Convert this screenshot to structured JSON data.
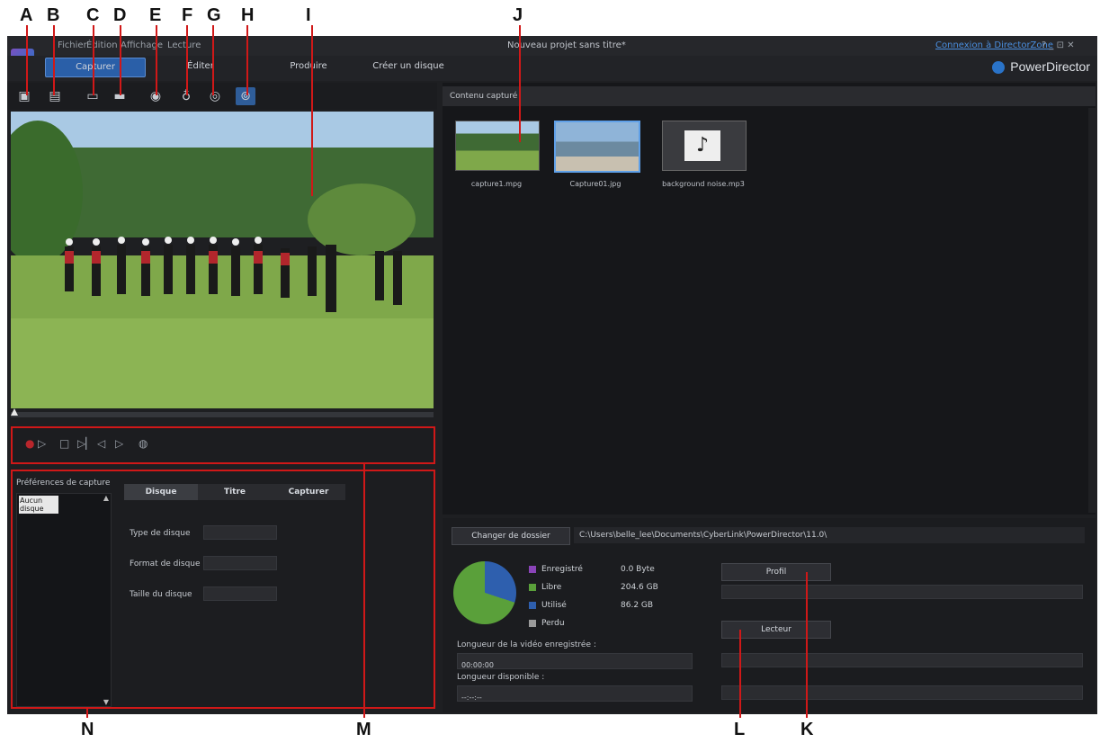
{
  "callouts": [
    "A",
    "B",
    "C",
    "D",
    "E",
    "F",
    "G",
    "H",
    "I",
    "J",
    "K",
    "L",
    "M",
    "N"
  ],
  "menu": {
    "items": [
      "Fichier",
      "Édition",
      "Affichage",
      "Lecture"
    ],
    "project_title": "Nouveau projet sans titre*",
    "connect_link": "Connexion à DirectorZone",
    "window_icons": "?  _  ⊡  ✕"
  },
  "modes": {
    "capture": "Capturer",
    "edit": "Éditer",
    "produce": "Produire",
    "disc": "Créer un disque"
  },
  "brand": {
    "name": "PowerDirector",
    "accent": "#2a73c8"
  },
  "toolbar_icons": [
    "capture-camera-icon",
    "capture-dv-icon",
    "capture-tv-icon",
    "capture-digital-tv-icon",
    "capture-webcam-icon",
    "capture-microphone-icon",
    "capture-cd-icon",
    "capture-dvd-icon"
  ],
  "content": {
    "header": "Contenu capturé",
    "items": [
      {
        "name": "capture1.mpg"
      },
      {
        "name": "Capture01.jpg"
      },
      {
        "name": "background noise.mp3"
      }
    ]
  },
  "folder": {
    "change_label": "Changer de dossier",
    "path": "C:\\Users\\belle_lee\\Documents\\CyberLink\\PowerDirector\\11.0\\"
  },
  "disk": {
    "recorded": {
      "label": "Enregistré",
      "value": "0.0  Byte",
      "color": "#8a44b8"
    },
    "free": {
      "label": "Libre",
      "value": "204.6  GB",
      "color": "#5aa03a"
    },
    "used": {
      "label": "Utilisé",
      "value": "86.2  GB",
      "color": "#2e5fae"
    },
    "lost": {
      "label": "Perdu",
      "value": "",
      "color": "#9a9a9a"
    },
    "used_fraction": 0.296
  },
  "lengths": {
    "recorded_label": "Longueur de la vidéo enregistrée :",
    "recorded_value": "00:00:00",
    "available_label": "Longueur disponible :",
    "available_value": "--:--:--"
  },
  "buttons": {
    "profile": "Profil",
    "player": "Lecteur"
  },
  "prefs": {
    "title": "Préférences de capture",
    "list_item": "Aucun disque",
    "tabs": [
      "Disque",
      "Titre",
      "Capturer"
    ],
    "fields": [
      "Type de disque",
      "Format de disque",
      "Taille du disque"
    ]
  }
}
